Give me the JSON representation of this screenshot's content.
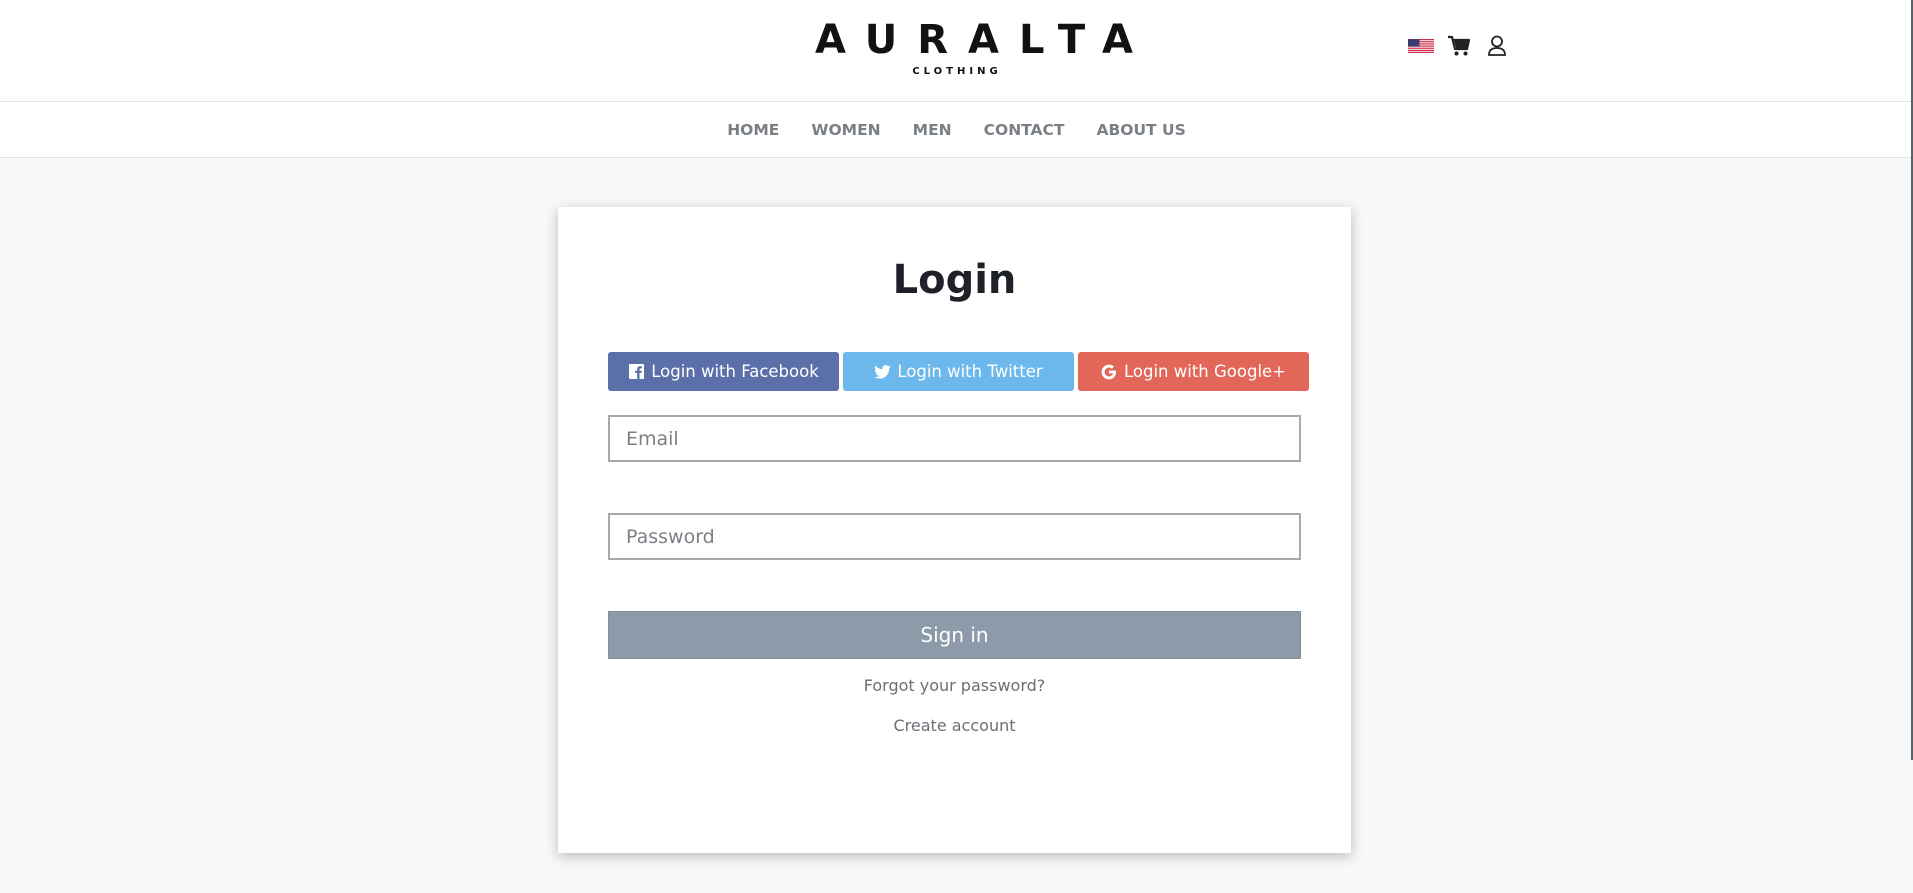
{
  "brand": {
    "name": "AURALTA",
    "tagline": "CLOTHING"
  },
  "top_icons": {
    "flag": "us-flag-icon",
    "cart": "cart-icon",
    "account": "user-icon"
  },
  "nav": {
    "items": [
      "HOME",
      "WOMEN",
      "MEN",
      "CONTACT",
      "ABOUT US"
    ]
  },
  "login": {
    "title": "Login",
    "social": {
      "facebook": "Login with Facebook",
      "twitter": "Login with Twitter",
      "google": "Login with Google+"
    },
    "email_placeholder": "Email",
    "password_placeholder": "Password",
    "signin_label": "Sign in",
    "forgot_label": "Forgot your password?",
    "create_label": "Create account"
  },
  "colors": {
    "facebook": "#5b6fa9",
    "twitter": "#6cb7ec",
    "google": "#e26759",
    "signin": "#8c9aaa",
    "page_bg": "#f7f8fa"
  }
}
